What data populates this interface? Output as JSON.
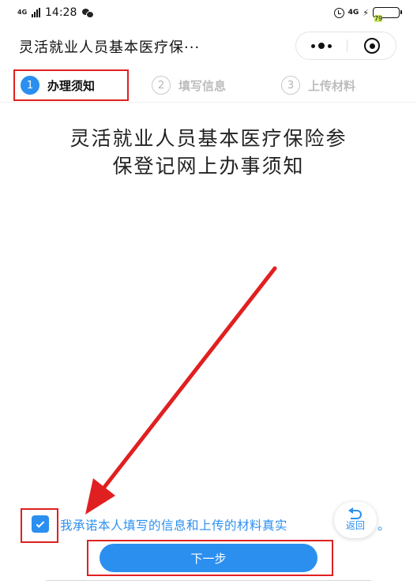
{
  "status_bar": {
    "network_tag": "4G",
    "time": "14:28",
    "network_right": "4G",
    "battery": "79",
    "battery_level": 0.79
  },
  "nav": {
    "title": "灵活就业人员基本医疗保···",
    "more_icon": "more-dots-icon",
    "close_icon": "target-close-icon"
  },
  "steps": [
    {
      "number": "1",
      "label": "办理须知",
      "active": true
    },
    {
      "number": "2",
      "label": "填写信息",
      "active": false
    },
    {
      "number": "3",
      "label": "上传材料",
      "active": false
    }
  ],
  "document": {
    "title_line1": "灵活就业人员基本医疗保险参",
    "title_line2": "保登记网上办事须知"
  },
  "agreement": {
    "checked": true,
    "text": "我承诺本人填写的信息和上传的材料真实",
    "tail": "。"
  },
  "back_float": {
    "label": "返回"
  },
  "next_button": {
    "label": "下一步"
  },
  "colors": {
    "accent": "#2b8ff0",
    "annotation_red": "#e02020"
  }
}
